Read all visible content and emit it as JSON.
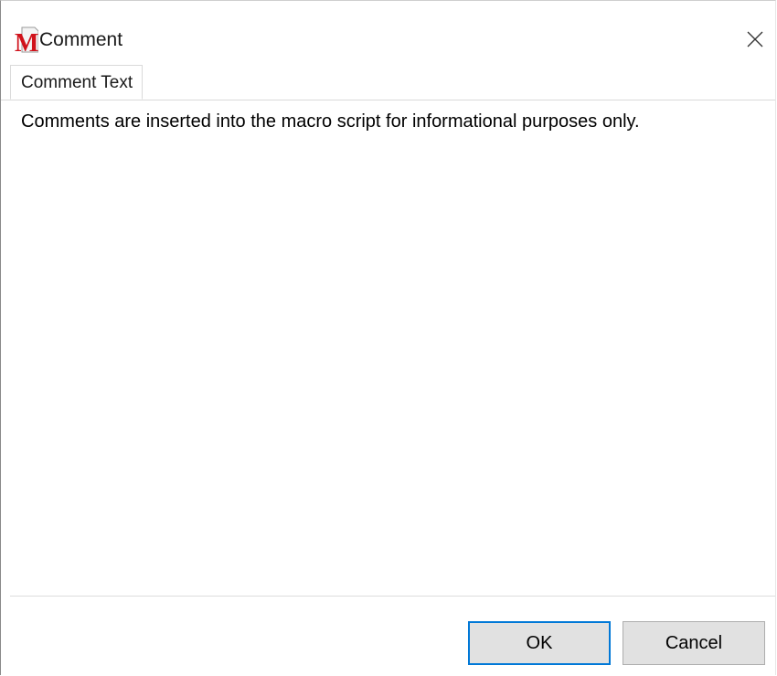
{
  "window": {
    "title": "Comment",
    "app_icon": "macro-m-icon",
    "close_icon": "close-icon"
  },
  "tabs": [
    {
      "label": "Comment Text",
      "selected": true
    }
  ],
  "content": {
    "text": "Comments are inserted into the macro script for informational purposes only."
  },
  "buttons": {
    "ok_label": "OK",
    "cancel_label": "Cancel"
  },
  "colors": {
    "icon_red": "#d0121b",
    "focus_blue": "#0078d7",
    "button_face": "#e1e1e1"
  }
}
